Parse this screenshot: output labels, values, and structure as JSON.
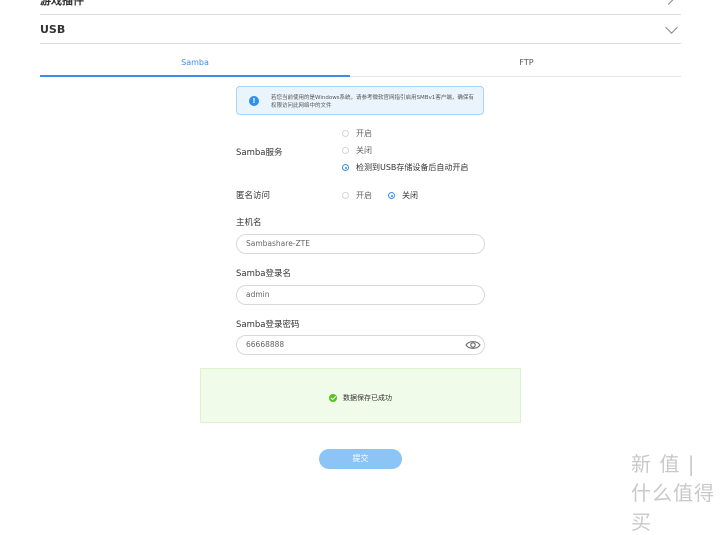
{
  "sections": {
    "game_plugins_title": "游戏插件",
    "usb_title": "USB"
  },
  "tabs": [
    {
      "label": "Samba",
      "active": true
    },
    {
      "label": "FTP",
      "active": false
    }
  ],
  "notice": {
    "icon": "info-icon",
    "text": "若您当前使用的是Windows系统，请参考微软官网指引启用SMBv1客户端，确保有权限访问此网络中的文件"
  },
  "form": {
    "samba_service": {
      "label": "Samba服务",
      "options": [
        "开启",
        "关闭",
        "检测到USB存储设备后自动开启"
      ],
      "selected": "检测到USB存储设备后自动开启"
    },
    "anonymous_access": {
      "label": "匿名访问",
      "options": [
        "开启",
        "关闭"
      ],
      "selected": "关闭"
    },
    "hostname": {
      "label": "主机名",
      "value": "Sambashare-ZTE"
    },
    "login_name": {
      "label": "Samba登录名",
      "value": "admin"
    },
    "login_password": {
      "label": "Samba登录密码",
      "value": "66668888",
      "icon": "eye-icon"
    }
  },
  "success_message": "数据保存已成功",
  "submit_label": "提交",
  "watermark": "新 值 | 什么值得买",
  "colors": {
    "accent": "#3a8ee6",
    "submit_bg": "#8cc4f5",
    "success_bg": "#f1fbe9",
    "notice_bg": "#e9f4fd"
  }
}
